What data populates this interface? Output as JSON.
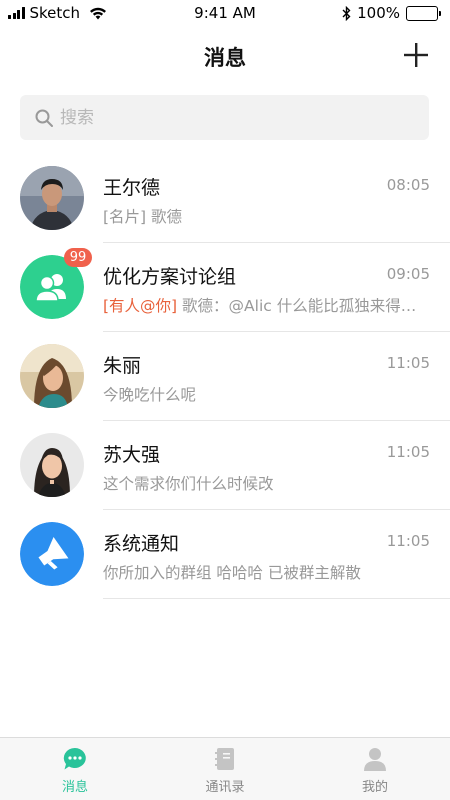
{
  "status_bar": {
    "carrier": "Sketch",
    "time": "9:41 AM",
    "battery_percent": "100%",
    "battery_level": 1.0
  },
  "header": {
    "title": "消息",
    "add_icon": "plus-icon"
  },
  "search": {
    "placeholder": "搜索",
    "value": "",
    "icon": "search-icon"
  },
  "conversations": [
    {
      "name": "王尔德",
      "time": "08:05",
      "prefix": "",
      "preview": "[名片] 歌德",
      "avatar": "photo",
      "badge": ""
    },
    {
      "name": "优化方案讨论组",
      "time": "09:05",
      "prefix": "[有人@你]",
      "preview": " 歌德：@Alic 什么能比孤独来得更…",
      "avatar": "group-icon",
      "badge": "99"
    },
    {
      "name": "朱丽",
      "time": "11:05",
      "prefix": "",
      "preview": "今晚吃什么呢",
      "avatar": "photo",
      "badge": ""
    },
    {
      "name": "苏大强",
      "time": "11:05",
      "prefix": "",
      "preview": "这个需求你们什么时候改",
      "avatar": "photo",
      "badge": ""
    },
    {
      "name": "系统通知",
      "time": "11:05",
      "prefix": "",
      "preview": "你所加入的群组 哈哈哈 已被群主解散",
      "avatar": "megaphone-icon",
      "badge": ""
    }
  ],
  "tabs": [
    {
      "label": "消息",
      "icon": "chat-bubble-icon",
      "active": true
    },
    {
      "label": "通讯录",
      "icon": "contacts-book-icon",
      "active": false
    },
    {
      "label": "我的",
      "icon": "person-icon",
      "active": false
    }
  ],
  "colors": {
    "accent": "#29c39a",
    "badge": "#f0614c",
    "mention": "#e8623c",
    "group_avatar": "#2dd08f",
    "system_avatar": "#2b8ff0"
  }
}
